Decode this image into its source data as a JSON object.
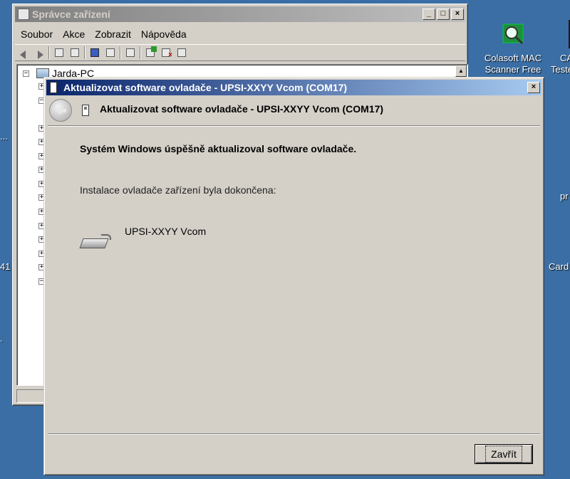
{
  "desktop": {
    "icons": [
      {
        "label_line1": "Colasoft MAC",
        "label_line2": "Scanner Free"
      },
      {
        "label_line1": "CA",
        "label_line2": "Teste"
      }
    ],
    "edge_labels": [
      "...",
      "pr",
      "Card",
      "41",
      "."
    ]
  },
  "device_manager": {
    "title": "Správce zařízení",
    "menu": [
      "Soubor",
      "Akce",
      "Zobrazit",
      "Nápověda"
    ],
    "tree_root": "Jarda-PC",
    "caption_buttons": {
      "minimize": "_",
      "maximize": "□",
      "close": "×"
    }
  },
  "dialog": {
    "title": "Aktualizovat software ovladače - UPSI-XXYY Vcom (COM17)",
    "close_glyph": "×",
    "header_text": "Aktualizovat software ovladače - UPSI-XXYY Vcom (COM17)",
    "success_message": "Systém Windows úspěšně aktualizoval software ovladače.",
    "install_message": "Instalace ovladače zařízení byla dokončena:",
    "device_name": "UPSI-XXYY Vcom",
    "close_button_label": "Zavřít"
  }
}
